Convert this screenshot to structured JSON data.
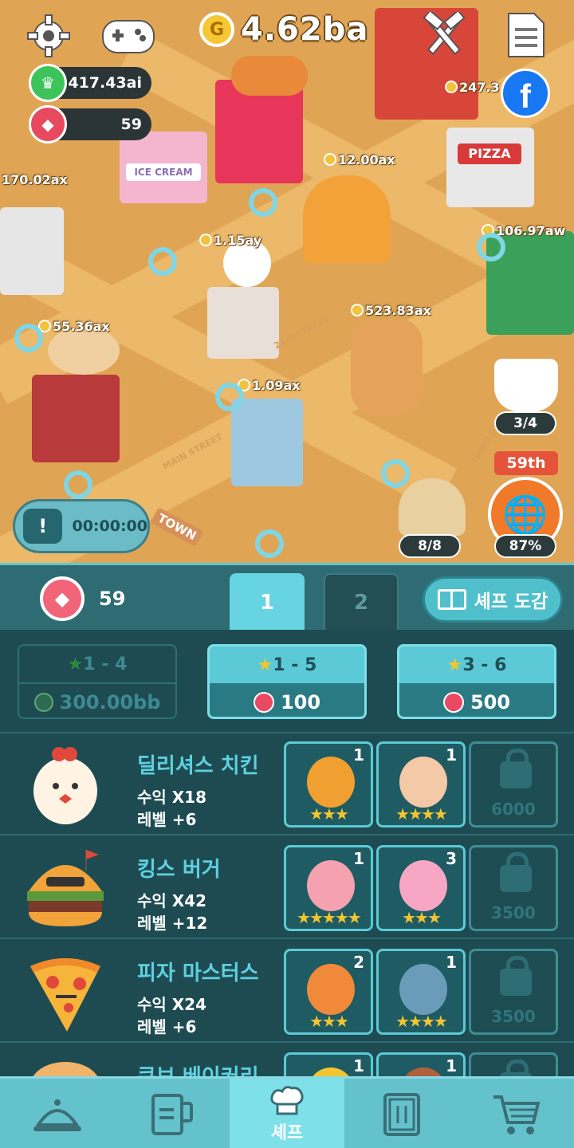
{
  "hud": {
    "gold": "4.62ba",
    "gold_coin_letter": "G",
    "crown_value": "417.43ai",
    "gem_value": "59"
  },
  "map_labels": [
    {
      "id": "l1",
      "text": "170.02ax"
    },
    {
      "id": "l2",
      "text": "1.15ay"
    },
    {
      "id": "l3",
      "text": "12.00ax"
    },
    {
      "id": "l4",
      "text": "106.97aw"
    },
    {
      "id": "l5",
      "text": "55.36ax"
    },
    {
      "id": "l6",
      "text": "523.83ax"
    },
    {
      "id": "l7",
      "text": "1.09ax"
    },
    {
      "id": "l8",
      "text": "247.3"
    }
  ],
  "map_signs": {
    "ice_cream": "ICE CREAM",
    "pizza": "PIZZA",
    "street": "21st STREET",
    "main_street": "MAIN STREET",
    "third_st": "THIRD ST",
    "town": "TOWN"
  },
  "tv_timer": "00:00:00",
  "tv_icon_glyph": "!",
  "coffee_badge": "3/4",
  "explorer_badge": "8/8",
  "rank": "59th",
  "rank_percent": "87%",
  "panel": {
    "gem_count": "59",
    "tabs": [
      "1",
      "2"
    ],
    "dictionary_label": "셰프 도감",
    "hire_cards": [
      {
        "range": "1 - 4",
        "cost": "300.00bb",
        "currency": "gold",
        "enabled": false
      },
      {
        "range": "1 - 5",
        "cost": "100",
        "currency": "gem",
        "enabled": true
      },
      {
        "range": "3 - 6",
        "cost": "500",
        "currency": "gem",
        "enabled": true
      }
    ]
  },
  "restaurants": [
    {
      "name": "딜리셔스 치킨",
      "income": "수익 X18",
      "level": "레벨 +6",
      "slots": [
        {
          "count": "1",
          "stars": "★★★",
          "color": "#f0a030"
        },
        {
          "count": "1",
          "stars": "★★★★",
          "color": "#f3c9a8"
        }
      ],
      "lock_cost": "6000"
    },
    {
      "name": "킹스 버거",
      "income": "수익 X42",
      "level": "레벨 +12",
      "slots": [
        {
          "count": "1",
          "stars": "★★★★★",
          "color": "#f4a1b0"
        },
        {
          "count": "3",
          "stars": "★★★",
          "color": "#f7a7c4"
        }
      ],
      "lock_cost": "3500"
    },
    {
      "name": "피자 마스터스",
      "income": "수익 X24",
      "level": "레벨 +6",
      "slots": [
        {
          "count": "2",
          "stars": "★★★",
          "color": "#f08a3a"
        },
        {
          "count": "1",
          "stars": "★★★★",
          "color": "#6a9bb8"
        }
      ],
      "lock_cost": "3500"
    },
    {
      "name": "쿠브 베이커리",
      "income": "",
      "level": "",
      "slots": [
        {
          "count": "1",
          "stars": "",
          "color": "#f2c531"
        },
        {
          "count": "1",
          "stars": "",
          "color": "#b0603a"
        }
      ],
      "lock_cost": ""
    }
  ],
  "nav": [
    {
      "id": "dish",
      "label": ""
    },
    {
      "id": "kitchen",
      "label": ""
    },
    {
      "id": "chef",
      "label": "셰프"
    },
    {
      "id": "menu",
      "label": ""
    },
    {
      "id": "shop",
      "label": ""
    }
  ]
}
